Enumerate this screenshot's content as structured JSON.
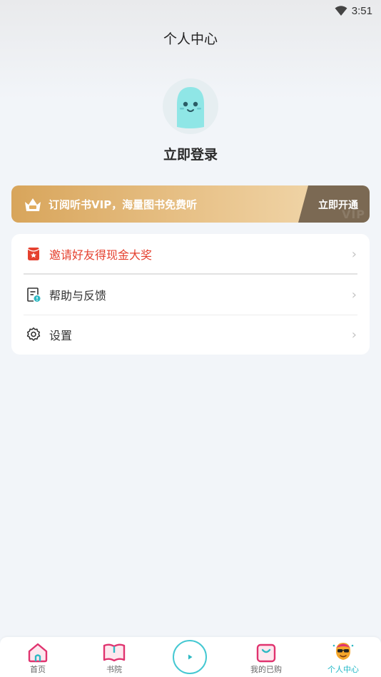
{
  "status_bar": {
    "time": "3:51",
    "icons": [
      "wifi-icon"
    ]
  },
  "header": {
    "title": "个人中心"
  },
  "profile": {
    "avatar_icon": "ghost-avatar-icon",
    "login_label": "立即登录"
  },
  "vip_banner": {
    "icon": "vip-crown-icon",
    "text": "订阅听书VIP，海量图书免费听",
    "button_label": "立即开通",
    "watermark": "VIP",
    "colors": {
      "start": "#d8a55b",
      "end": "#f3dcb4",
      "button": "#7b6953"
    }
  },
  "menu": {
    "items": [
      {
        "icon": "red-envelope-icon",
        "label": "邀请好友得现金大奖",
        "highlight": true
      },
      {
        "icon": "feedback-icon",
        "label": "帮助与反馈",
        "highlight": false
      },
      {
        "icon": "settings-gear-icon",
        "label": "设置",
        "highlight": false
      }
    ],
    "chevron": "›"
  },
  "bottom_nav": {
    "items": [
      {
        "label": "首页",
        "icon": "home-icon",
        "active": false
      },
      {
        "label": "书院",
        "icon": "book-icon",
        "active": false
      },
      {
        "label": "",
        "icon": "play-icon",
        "active": false
      },
      {
        "label": "我的已购",
        "icon": "bag-icon",
        "active": false
      },
      {
        "label": "个人中心",
        "icon": "profile-mascot-icon",
        "active": true
      }
    ],
    "colors": {
      "accent": "#e0336f",
      "active": "#21b8c7",
      "play_ring": "#45c8d2"
    }
  }
}
